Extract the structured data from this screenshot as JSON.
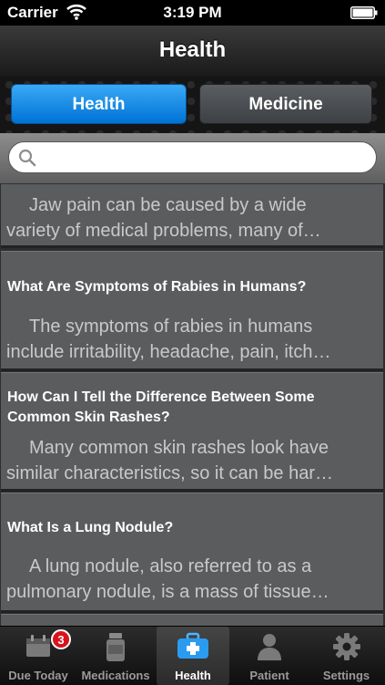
{
  "status_bar": {
    "carrier": "Carrier",
    "time": "3:19 PM"
  },
  "nav": {
    "title": "Health"
  },
  "segments": {
    "health": "Health",
    "medicine": "Medicine",
    "selected": "Health"
  },
  "search": {
    "value": "",
    "placeholder": ""
  },
  "articles": [
    {
      "title": "",
      "desc_line1": "Jaw pain can be caused by a wide",
      "desc_line2": "variety of medical problems, many of…"
    },
    {
      "title": "What Are Symptoms of Rabies in Humans?",
      "desc_line1": "The symptoms of rabies in humans",
      "desc_line2": "include irritability, headache, pain, itch…"
    },
    {
      "title": "How Can I Tell the Difference Between Some Common Skin Rashes?",
      "desc_line1": "Many common skin rashes look have",
      "desc_line2": "similar characteristics, so it can be har…"
    },
    {
      "title": "What Is a Lung Nodule?",
      "desc_line1": "A lung nodule, also referred to as a",
      "desc_line2": "pulmonary nodule, is a mass of tissue…"
    }
  ],
  "tab_bar": {
    "tabs": [
      {
        "label": "Due Today",
        "icon": "calendar-icon",
        "badge": "3"
      },
      {
        "label": "Medications",
        "icon": "pill-bottle-icon"
      },
      {
        "label": "Health",
        "icon": "first-aid-kit-icon",
        "active": true
      },
      {
        "label": "Patient",
        "icon": "person-icon"
      },
      {
        "label": "Settings",
        "icon": "gear-icon"
      }
    ]
  },
  "colors": {
    "accent": "#0a8be8",
    "badge": "#d8131b"
  }
}
